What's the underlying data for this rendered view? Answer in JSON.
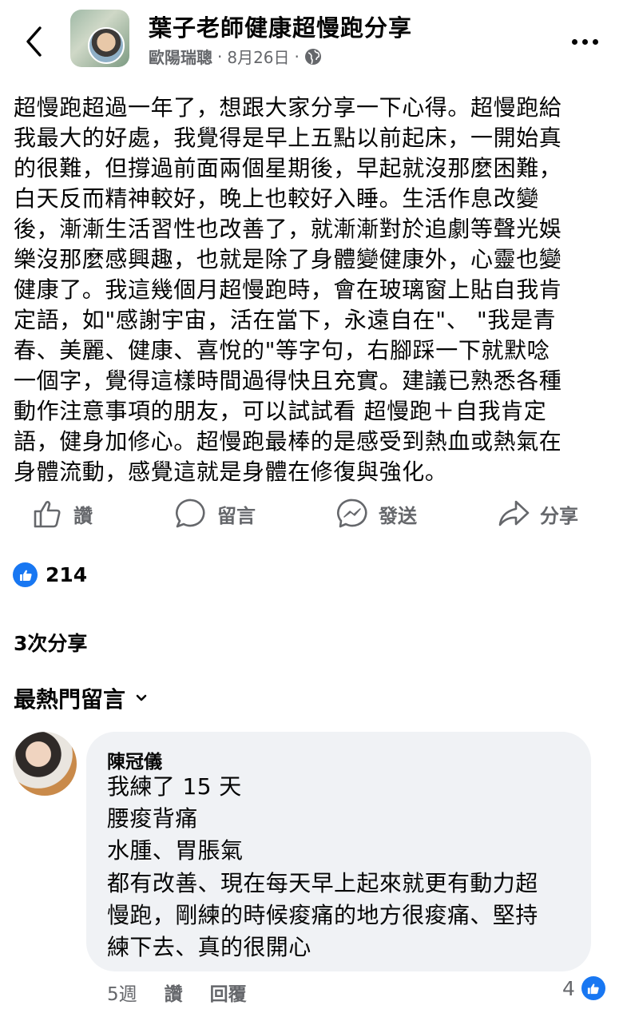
{
  "header": {
    "group_name": "葉子老師健康超慢跑分享",
    "author": "歐陽瑞聰",
    "separator": "·",
    "date": "8月26日",
    "separator2": "·",
    "privacy_icon": "globe-icon"
  },
  "post": {
    "lines": [
      "超慢跑超過一年了，想跟大家分享一下心得。超慢跑給",
      "我最大的好處，我覺得是早上五點以前起床，一開始真",
      "的很難，但撐過前面兩個星期後，早起就沒那麼困難，",
      "白天反而精神較好，晚上也較好入睡。生活作息改變",
      "後，漸漸生活習性也改善了，就漸漸對於追劇等聲光娛",
      "樂沒那麼感興趣，也就是除了身體變健康外，心靈也變",
      "健康了。我這幾個月超慢跑時，會在玻璃窗上貼自我肯",
      "定語，如\"感謝宇宙，活在當下，永遠自在\"、 \"我是青",
      "春、美麗、健康、喜悅的\"等字句，右腳踩一下就默唸",
      "一個字，覺得這樣時間過得快且充實。建議已熟悉各種",
      "動作注意事項的朋友，可以試試看 超慢跑＋自我肯定",
      "語，健身加修心。超慢跑最棒的是感受到熱血或熱氣在",
      "身體流動，感覺這就是身體在修復與強化。"
    ]
  },
  "actions": {
    "like": "讚",
    "comment": "留言",
    "send": "發送",
    "share": "分享"
  },
  "reactions": {
    "like_count": "214",
    "shares": "3次分享",
    "top_comments": "最熱門留言"
  },
  "comment": {
    "name": "陳冠儀",
    "lines": [
      "我練了 15 天",
      "腰痠背痛",
      "水腫、胃脹氣",
      "都有改善、現在每天早上起來就更有動力超",
      "慢跑，剛練的時候痠痛的地方很痠痛、堅持",
      "練下去、真的很開心"
    ],
    "time": "5週",
    "like_label": "讚",
    "reply_label": "回覆",
    "like_count": "4"
  },
  "colors": {
    "accent": "#1877f2",
    "secondary_text": "#65676b",
    "bubble_bg": "#f0f2f5"
  }
}
